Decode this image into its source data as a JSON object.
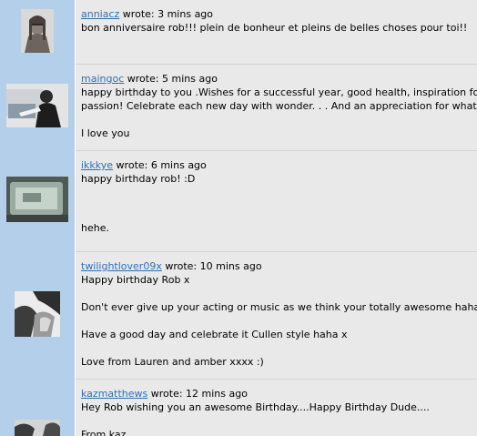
{
  "comments": [
    {
      "username": "anniacz",
      "wrote": " wrote: 3 mins ago",
      "lines": [
        "bon anniversaire rob!!! plein de bonheur et pleins de belles choses pour toi!!"
      ]
    },
    {
      "username": "maingoc",
      "wrote": " wrote: 5 mins ago",
      "lines": [
        "happy birthday to you .Wishes for a successful year, good health, inspiration for y",
        "passion! Celebrate each new day with wonder. . . And an appreciation for what it",
        "",
        "I love you"
      ]
    },
    {
      "username": "ikkkye",
      "wrote": " wrote: 6 mins ago",
      "lines": [
        "happy birthday rob! :D",
        "hehe."
      ]
    },
    {
      "username": "twilightlover09x",
      "wrote": " wrote: 10 mins ago",
      "lines": [
        "Happy birthday Rob x",
        "",
        "Don't ever give up your acting or music as we think your totally awesome haha",
        "",
        "Have a good day and celebrate it Cullen style haha x",
        "",
        "Love from Lauren and amber xxxx :)"
      ]
    },
    {
      "username": "kazmatthews",
      "wrote": " wrote: 12 mins ago",
      "lines": [
        "Hey Rob wishing you an awesome Birthday....Happy Birthday Dude....",
        "",
        "From kaz"
      ]
    }
  ],
  "avatars": [
    "avatar-photo-icon",
    "avatar-photo-icon",
    "avatar-photo-icon",
    "avatar-photo-icon",
    "avatar-photo-icon"
  ],
  "colors": {
    "avatar_column": "#b3cfe9",
    "comment_background": "#e9e9e9",
    "username_link": "#2f6fb5"
  }
}
